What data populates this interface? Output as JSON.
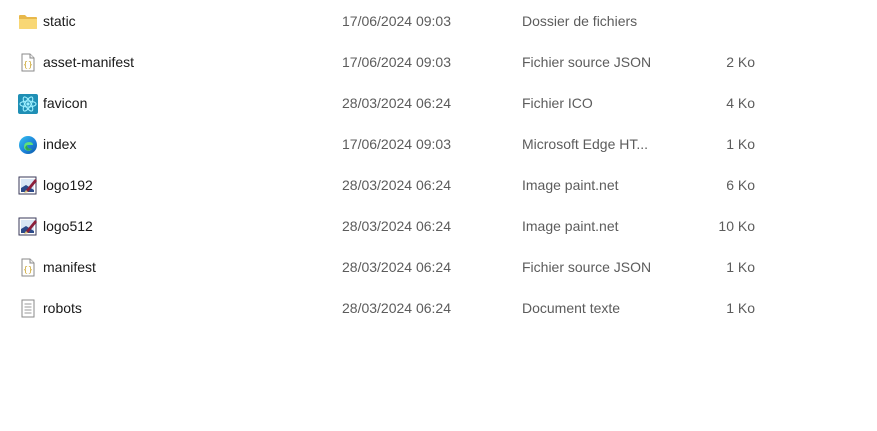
{
  "files": [
    {
      "name": "static",
      "date": "17/06/2024 09:03",
      "type": "Dossier de fichiers",
      "size": "",
      "icon": "folder-icon"
    },
    {
      "name": "asset-manifest",
      "date": "17/06/2024 09:03",
      "type": "Fichier source JSON",
      "size": "2 Ko",
      "icon": "json-file-icon"
    },
    {
      "name": "favicon",
      "date": "28/03/2024 06:24",
      "type": "Fichier ICO",
      "size": "4 Ko",
      "icon": "react-icon"
    },
    {
      "name": "index",
      "date": "17/06/2024 09:03",
      "type": "Microsoft Edge HT...",
      "size": "1 Ko",
      "icon": "edge-icon"
    },
    {
      "name": "logo192",
      "date": "28/03/2024 06:24",
      "type": "Image paint.net",
      "size": "6 Ko",
      "icon": "paintnet-icon"
    },
    {
      "name": "logo512",
      "date": "28/03/2024 06:24",
      "type": "Image paint.net",
      "size": "10 Ko",
      "icon": "paintnet-icon"
    },
    {
      "name": "manifest",
      "date": "28/03/2024 06:24",
      "type": "Fichier source JSON",
      "size": "1 Ko",
      "icon": "json-file-icon"
    },
    {
      "name": "robots",
      "date": "28/03/2024 06:24",
      "type": "Document texte",
      "size": "1 Ko",
      "icon": "text-file-icon"
    }
  ]
}
